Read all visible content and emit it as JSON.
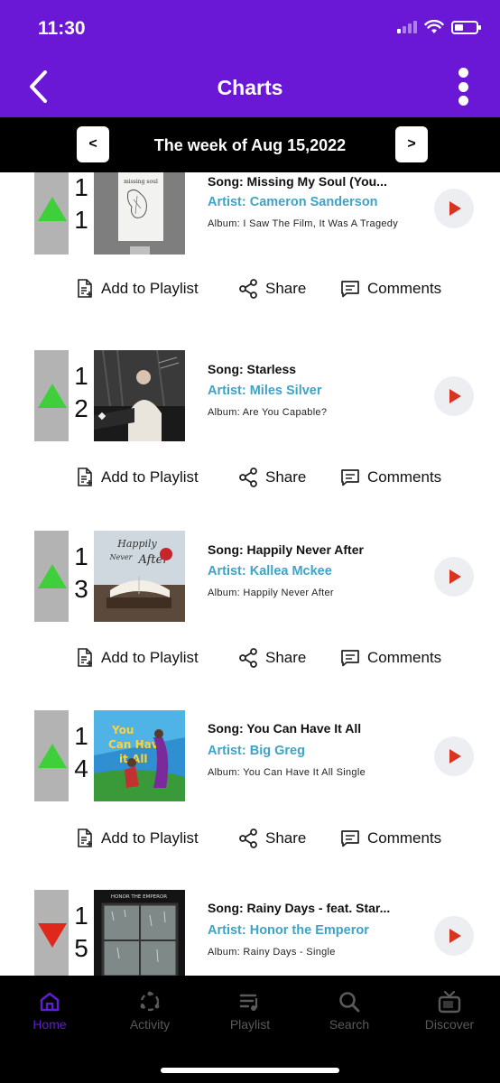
{
  "status": {
    "time": "11:30"
  },
  "header": {
    "title": "Charts"
  },
  "week": {
    "label": "The week of Aug 15,2022",
    "prev": "<",
    "next": ">"
  },
  "actions": {
    "playlist": "Add to Playlist",
    "share": "Share",
    "comments": "Comments"
  },
  "entries": [
    {
      "rank_tens": "1",
      "rank_ones": "1",
      "trend": "up",
      "song": "Song: Missing My Soul (You...",
      "artist": "Artist: Cameron Sanderson",
      "album": "Album: I Saw The Film, It Was A Tragedy"
    },
    {
      "rank_tens": "1",
      "rank_ones": "2",
      "trend": "up",
      "song": "Song: Starless",
      "artist": "Artist: Miles Silver",
      "album": "Album: Are You Capable?"
    },
    {
      "rank_tens": "1",
      "rank_ones": "3",
      "trend": "up",
      "song": "Song: Happily Never After",
      "artist": "Artist: Kallea Mckee",
      "album": "Album: Happily Never After"
    },
    {
      "rank_tens": "1",
      "rank_ones": "4",
      "trend": "up",
      "song": "Song: You Can Have It All",
      "artist": "Artist: Big Greg",
      "album": "Album: You Can Have It All Single"
    },
    {
      "rank_tens": "1",
      "rank_ones": "5",
      "trend": "down",
      "song": "Song: Rainy Days - feat. Star...",
      "artist": "Artist: Honor the Emperor",
      "album": "Album: Rainy Days - Single"
    }
  ],
  "covers": {
    "c1_title": "missing soul",
    "c3_title_1": "Happily",
    "c3_title_2": "Never",
    "c3_title_3": "After",
    "c4_title_1": "You",
    "c4_title_2": "Can Have",
    "c4_title_3": "it All",
    "c5_title": "HONOR THE EMPEROR"
  },
  "tabs": [
    {
      "label": "Home",
      "icon": "home-icon",
      "active": true
    },
    {
      "label": "Activity",
      "icon": "activity-icon",
      "active": false
    },
    {
      "label": "Playlist",
      "icon": "playlist-icon",
      "active": false
    },
    {
      "label": "Search",
      "icon": "search-icon",
      "active": false
    },
    {
      "label": "Discover",
      "icon": "tv-icon",
      "active": false
    }
  ],
  "colors": {
    "header": "#6a17d6",
    "artist": "#3ea3c6",
    "trend_up": "#3fcf3a",
    "trend_down": "#e0271b",
    "play": "#d9341f",
    "tab_active": "#5f1fd1"
  }
}
